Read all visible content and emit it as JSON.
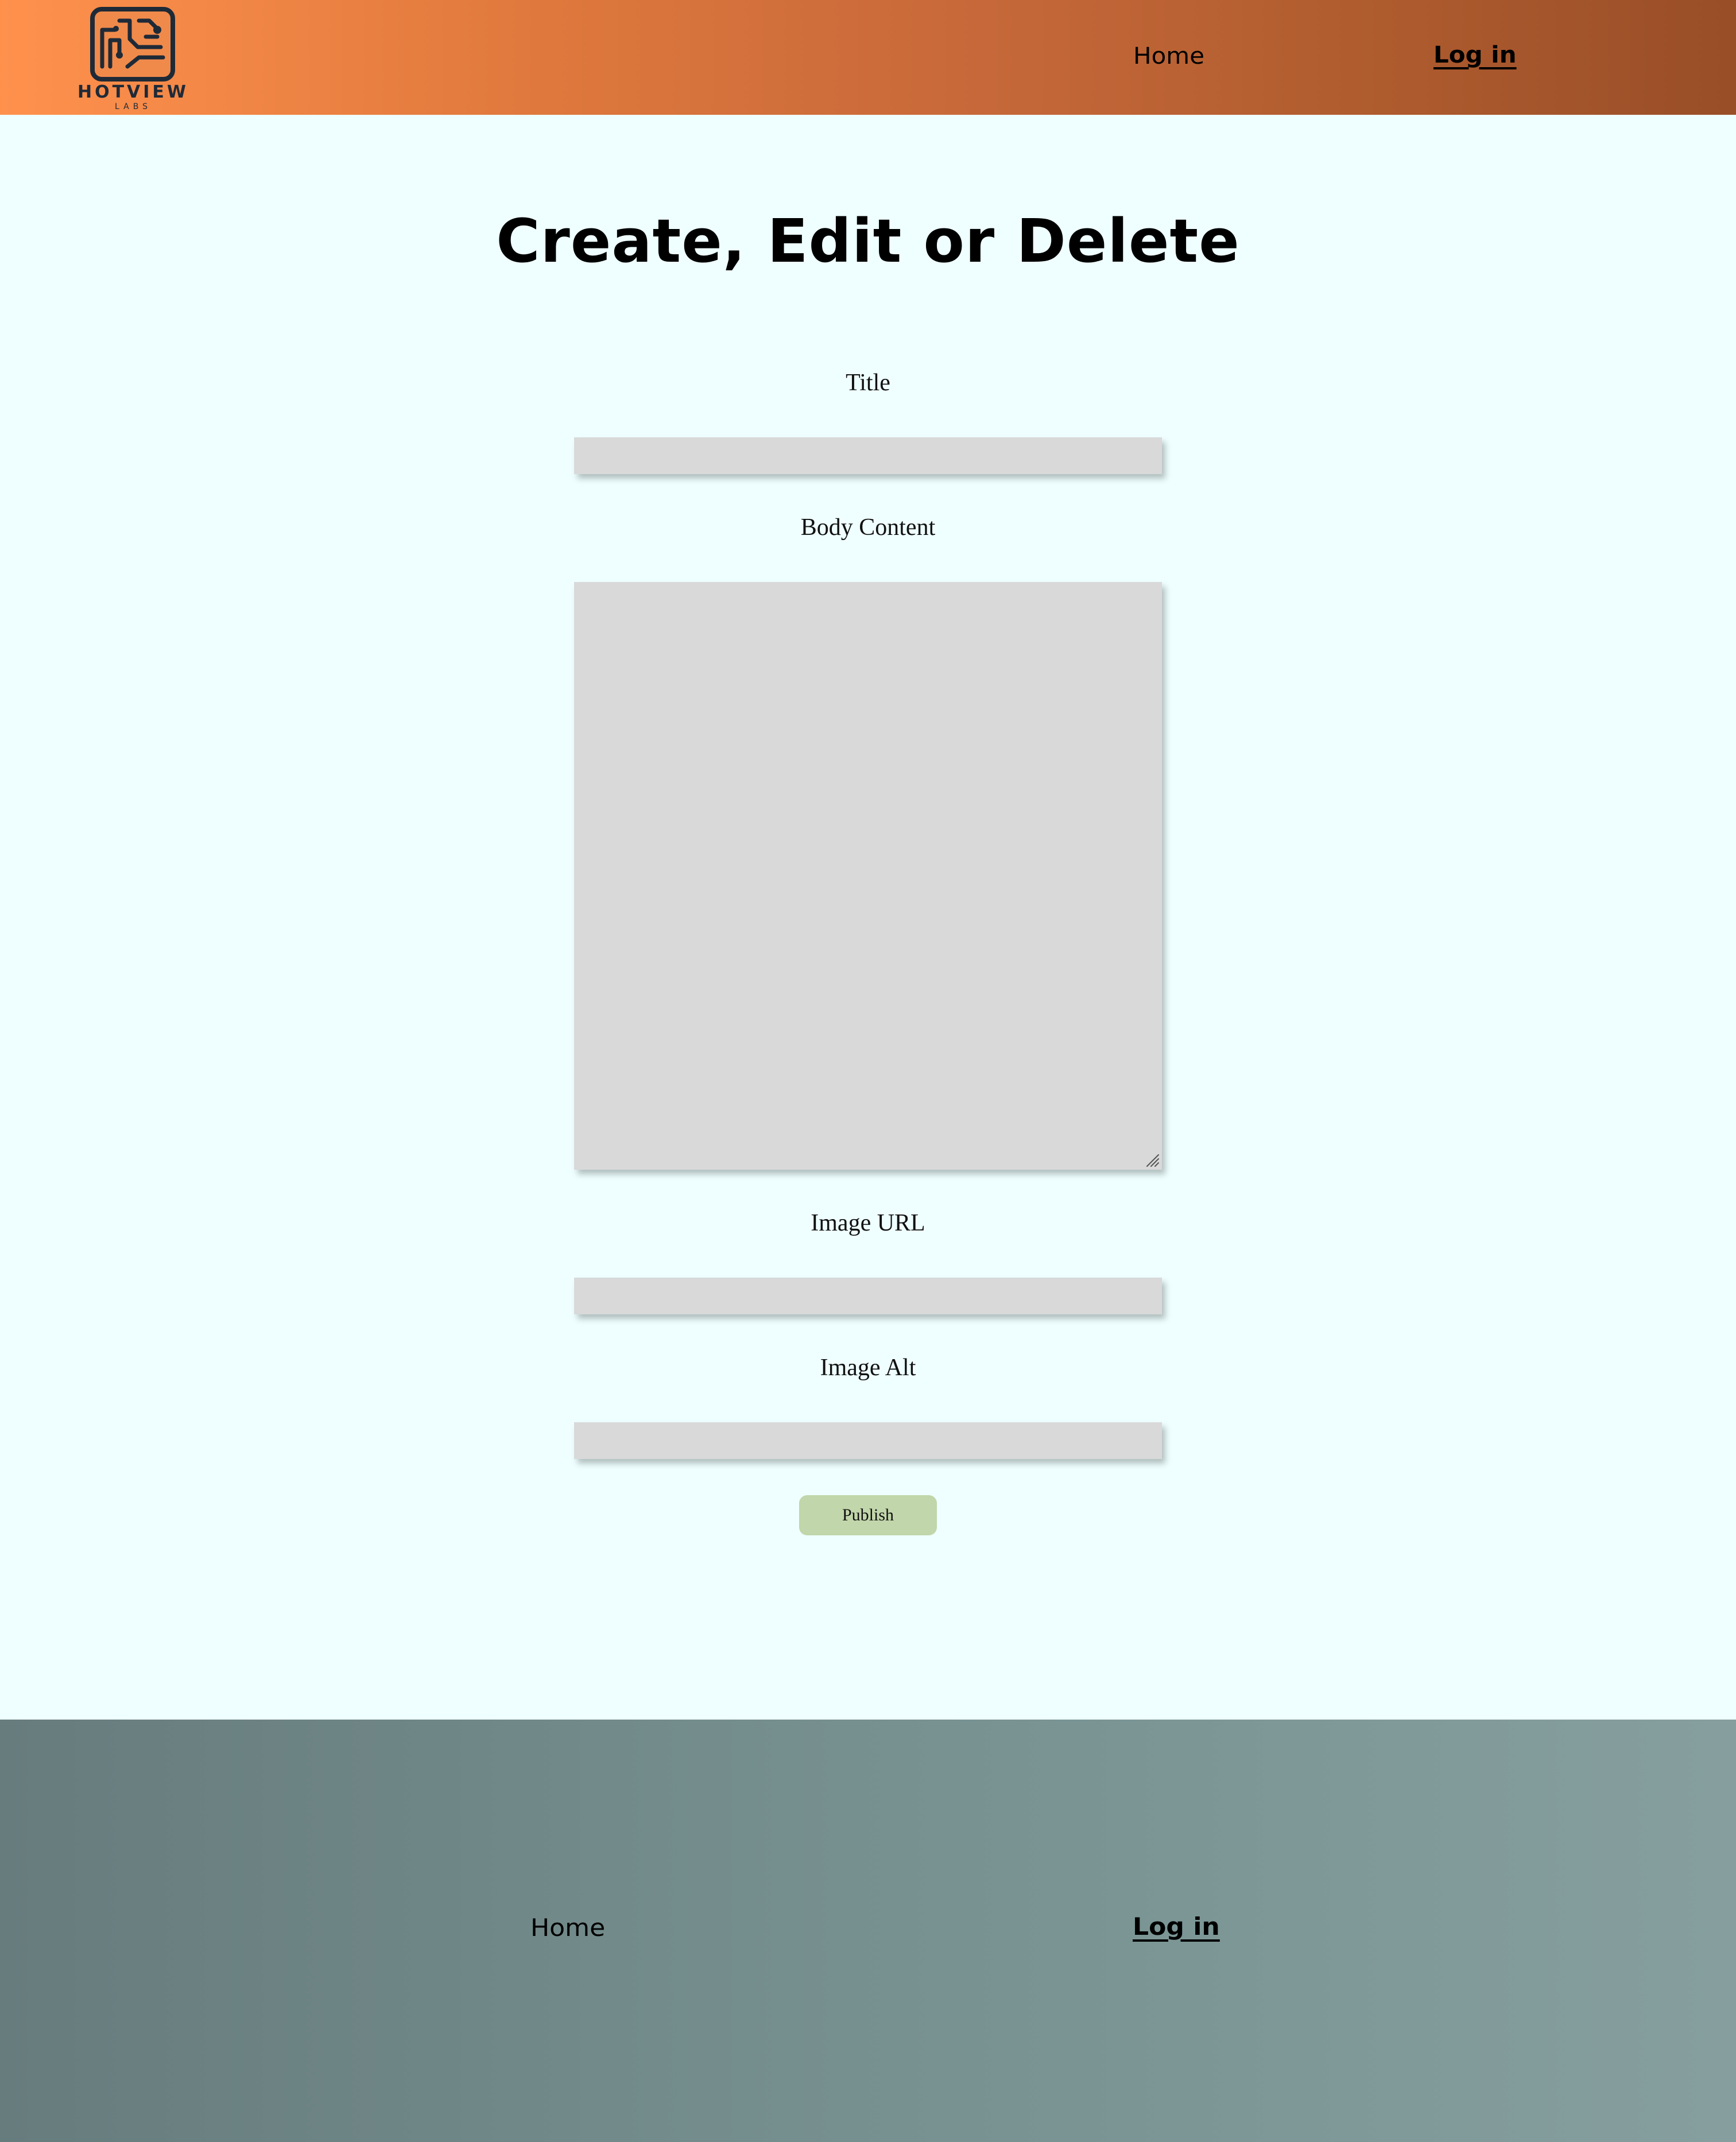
{
  "header": {
    "logo": {
      "name": "HOTVIEW",
      "subname": "LABS",
      "icon": "circuit-board-icon",
      "colors": {
        "mark_fill": "#f08a4b",
        "mark_outline": "#1f2a37"
      }
    },
    "nav": {
      "home": "Home",
      "login": "Log in"
    },
    "gradient": [
      "#ff914d",
      "#994e27"
    ]
  },
  "main": {
    "title": "Create, Edit or Delete",
    "form": {
      "title_label": "Title",
      "title_value": "",
      "body_label": "Body Content",
      "body_value": "",
      "image_url_label": "Image URL",
      "image_url_value": "",
      "image_alt_label": "Image Alt",
      "image_alt_value": "",
      "publish_label": "Publish"
    },
    "colors": {
      "background": "#efffff",
      "field": "#d9d9d9",
      "publish_button": "#c1d6aa"
    }
  },
  "footer": {
    "nav": {
      "home": "Home",
      "login": "Log in"
    },
    "gradient": [
      "#677c7d",
      "#869e9e"
    ]
  }
}
